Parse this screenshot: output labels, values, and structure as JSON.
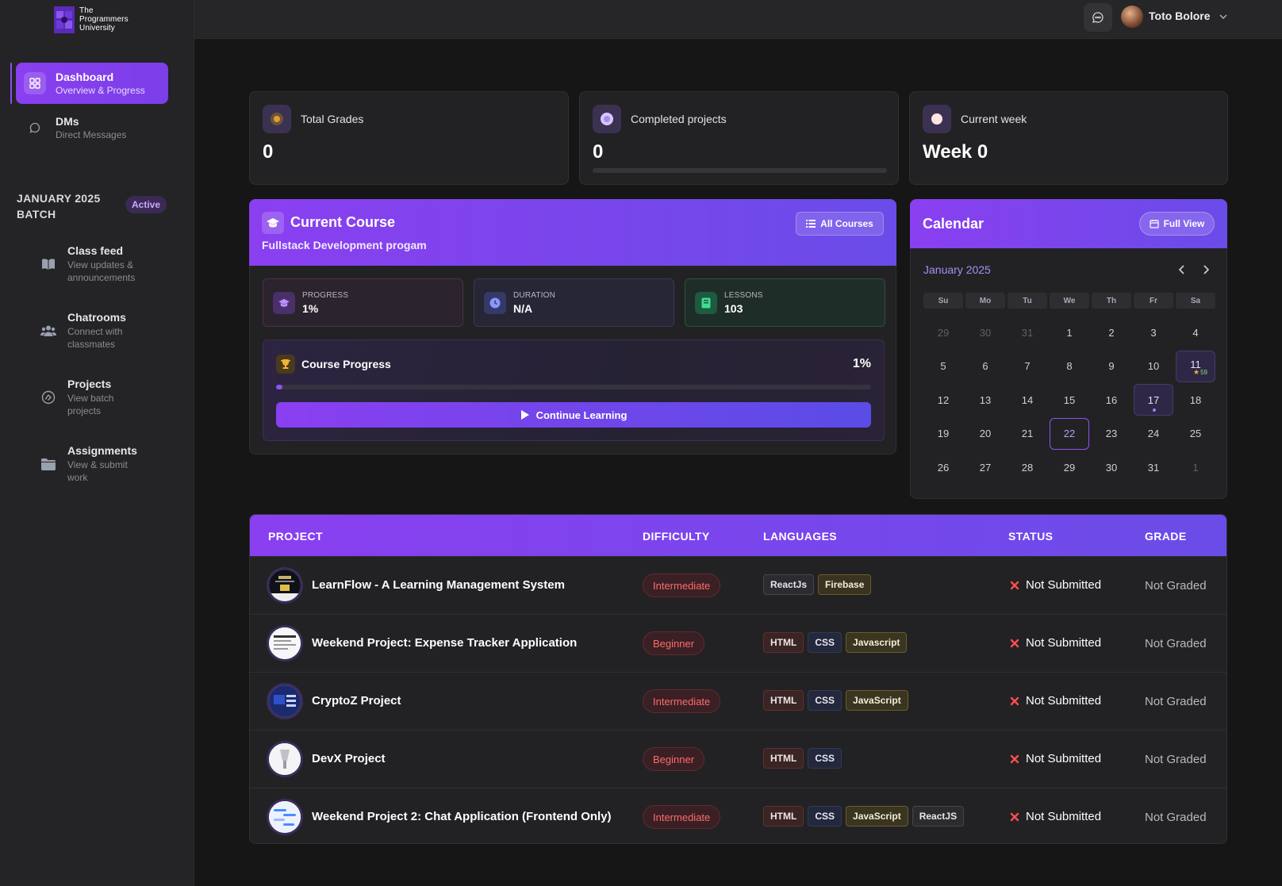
{
  "brand": {
    "logo_lines": [
      "The",
      "Programmers",
      "University"
    ]
  },
  "sidebar": {
    "nav": [
      {
        "title": "Dashboard",
        "sub": "Overview & Progress",
        "icon": "dashboard-icon"
      },
      {
        "title": "DMs",
        "sub": "Direct Messages",
        "icon": "message-circle-icon"
      }
    ],
    "batch": {
      "title": "JANUARY 2025 BATCH",
      "badge": "Active"
    },
    "sections": [
      {
        "title": "Class feed",
        "sub_lines": [
          "View updates &",
          "announcements"
        ],
        "icon": "book-open-icon"
      },
      {
        "title": "Chatrooms",
        "sub_lines": [
          "Connect with",
          "classmates"
        ],
        "icon": "users-icon"
      },
      {
        "title": "Projects",
        "sub_lines": [
          "View batch",
          "projects"
        ],
        "icon": "projects-icon"
      },
      {
        "title": "Assignments",
        "sub_lines": [
          "View & submit",
          "work"
        ],
        "icon": "folder-icon"
      }
    ]
  },
  "topbar": {
    "user_name": "Toto Bolore"
  },
  "stats": [
    {
      "label": "Total Grades",
      "value": "0",
      "icon": "grades-icon"
    },
    {
      "label": "Completed projects",
      "value": "0",
      "icon": "completed-icon",
      "progress": 0
    },
    {
      "label": "Current week",
      "value": "Week 0",
      "icon": "week-icon"
    }
  ],
  "course": {
    "title": "Current Course",
    "name": "Fullstack Development progam",
    "all_courses_label": "All Courses",
    "mini": [
      {
        "label": "PROGRESS",
        "value": "1%"
      },
      {
        "label": "DURATION",
        "value": "N/A"
      },
      {
        "label": "LESSONS",
        "value": "103"
      }
    ],
    "progress_title": "Course Progress",
    "progress_pct": "1%",
    "progress_value": 0.01,
    "continue_label": "Continue Learning"
  },
  "calendar": {
    "title": "Calendar",
    "full_view_label": "Full View",
    "month_label": "January 2025",
    "weekdays": [
      "Su",
      "Mo",
      "Tu",
      "We",
      "Th",
      "Fr",
      "Sa"
    ],
    "weeks": [
      [
        "29",
        "30",
        "31",
        "1",
        "2",
        "3",
        "4"
      ],
      [
        "5",
        "6",
        "7",
        "8",
        "9",
        "10",
        "11"
      ],
      [
        "12",
        "13",
        "14",
        "15",
        "16",
        "17",
        "18"
      ],
      [
        "19",
        "20",
        "21",
        "22",
        "23",
        "24",
        "25"
      ],
      [
        "26",
        "27",
        "28",
        "29",
        "30",
        "31",
        "1"
      ]
    ],
    "event_day": "11",
    "event_badge": "59",
    "dot_day": "17",
    "today": "22"
  },
  "table": {
    "headers": [
      "PROJECT",
      "DIFFICULTY",
      "LANGUAGES",
      "STATUS",
      "GRADE"
    ],
    "rows": [
      {
        "name": "LearnFlow - A Learning Management System",
        "difficulty": "Intermediate",
        "languages": [
          "ReactJs",
          "Firebase"
        ],
        "status": "Not Submitted",
        "grade": "Not Graded"
      },
      {
        "name": "Weekend Project: Expense Tracker Application",
        "difficulty": "Beginner",
        "languages": [
          "HTML",
          "CSS",
          "Javascript"
        ],
        "status": "Not Submitted",
        "grade": "Not Graded"
      },
      {
        "name": "CryptoZ Project",
        "difficulty": "Intermediate",
        "languages": [
          "HTML",
          "CSS",
          "JavaScript"
        ],
        "status": "Not Submitted",
        "grade": "Not Graded"
      },
      {
        "name": "DevX Project",
        "difficulty": "Beginner",
        "languages": [
          "HTML",
          "CSS"
        ],
        "status": "Not Submitted",
        "grade": "Not Graded"
      },
      {
        "name": "Weekend Project 2: Chat Application (Frontend Only)",
        "difficulty": "Intermediate",
        "languages": [
          "HTML",
          "CSS",
          "JavaScript",
          "ReactJS"
        ],
        "status": "Not Submitted",
        "grade": "Not Graded"
      }
    ]
  },
  "colors": {
    "accent": "#8a3ff0",
    "accent2": "#6a4ce8",
    "danger": "#ff4d4d"
  }
}
